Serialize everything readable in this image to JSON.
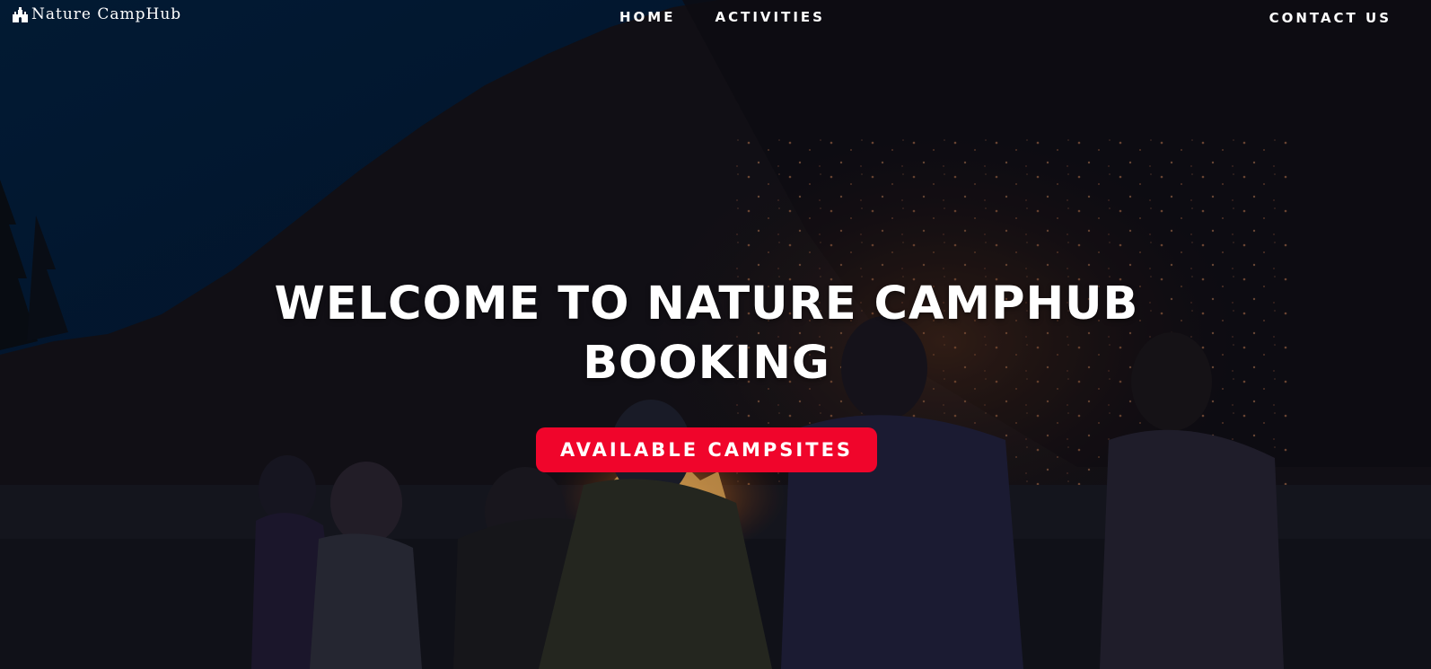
{
  "brand": {
    "name": "Nature CampHub",
    "icon": "castle-icon"
  },
  "nav": {
    "items": [
      {
        "label": "HOME"
      },
      {
        "label": "ACTIVITIES"
      }
    ],
    "contact": {
      "label": "CONTACT US"
    }
  },
  "hero": {
    "title_line1": "WELCOME TO NATURE CAMPHUB",
    "title_line2": "BOOKING",
    "cta_label": "AVAILABLE CAMPSITES",
    "background": "campfire-night-photo"
  },
  "colors": {
    "cta": "#f0052b",
    "sky": "#04213f",
    "text": "#ffffff"
  }
}
